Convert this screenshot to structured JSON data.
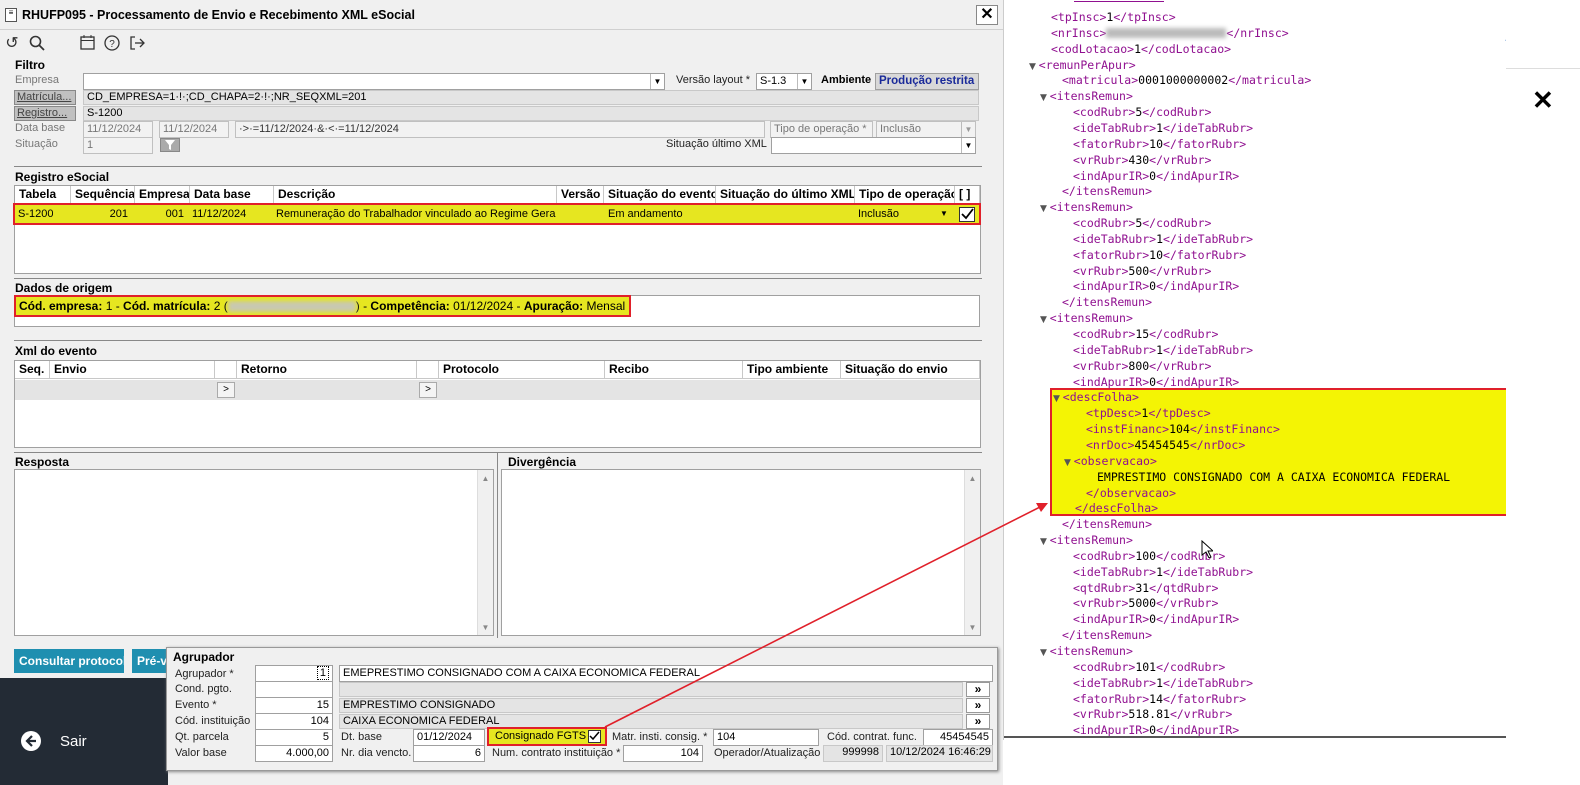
{
  "window": {
    "title": "RHUFP095 - Processamento de Envio e Recebimento XML eSocial",
    "close": "✕"
  },
  "toolbar": {
    "icons": [
      "refresh-icon",
      "search-icon",
      "calendar-icon",
      "help-icon",
      "exit-icon"
    ]
  },
  "filtro": {
    "title": "Filtro",
    "empresa_label": "Empresa",
    "empresa_value": "",
    "versao_label": "Versão layout *",
    "versao_value": "S-1.3",
    "ambiente_label": "Ambiente",
    "ambiente_value": "Produção restrita",
    "matricula_label": "Matrícula...",
    "matricula_value": "CD_EMPRESA=1·!·;CD_CHAPA=2·!·;NR_SEQXML=201",
    "registro_label": "Registro...",
    "registro_value": "S-1200",
    "database_label": "Data base",
    "date1": "11/12/2024",
    "date2": "11/12/2024",
    "date_expr": "·>·=11/12/2024·&·<·=11/12/2024",
    "tipo_op_label": "Tipo de operação *",
    "tipo_op_value": "Inclusão",
    "situacao_label": "Situação",
    "situacao_value": "1",
    "sit_ultimo_label": "Situação último XML",
    "sit_ultimo_value": ""
  },
  "registro": {
    "title": "Registro eSocial",
    "headers": [
      "Tabela",
      "Sequência",
      "Empresa",
      "Data base",
      "Descrição",
      "Versão",
      "Situação do evento",
      "Situação do último XML",
      "Tipo de operação",
      "[ ]"
    ],
    "row": {
      "tabela": "S-1200",
      "sequencia": "201",
      "empresa": "001",
      "database": "11/12/2024",
      "descricao": "Remuneração do Trabalhador vinculado ao Regime Geral d",
      "versao": "",
      "situacao": "Em andamento",
      "sit_ultimo": "",
      "tipo_op": "Inclusão"
    }
  },
  "origem": {
    "title": "Dados de origem",
    "l1": "Cód. empresa:",
    "v1": " 1 - ",
    "l2": "Cód. matrícula:",
    "v2": " 2 (",
    "v2b": ") - ",
    "l3": "Competência:",
    "v3": " 01/12/2024 - ",
    "l4": "Apuração:",
    "v4": " Mensal -"
  },
  "xml_evento": {
    "title": "Xml do evento",
    "headers": [
      "Seq.",
      "Envio",
      "",
      "Retorno",
      "",
      "Protocolo",
      "Recibo",
      "Tipo ambiente",
      "Situação do envio"
    ],
    "btn": ">"
  },
  "resposta": {
    "title": "Resposta"
  },
  "divergencia": {
    "title": "Divergência"
  },
  "buttons": {
    "consultar": "Consultar protocolo",
    "previa": "Pré-vis"
  },
  "sair": "Sair",
  "agrupador": {
    "title": "Agrupador",
    "agrupador_label": "Agrupador *",
    "agrupador_value": "1",
    "agrupador_desc": "EMEPRESTIMO CONSIGNADO COM A CAIXA ECONOMICA FEDERAL",
    "cond_label": "Cond. pgto.",
    "cond_value": "",
    "cond_desc": "",
    "evento_label": "Evento *",
    "evento_value": "15",
    "evento_desc": "EMPRESTIMO CONSIGNADO",
    "inst_label": "Cód. instituição",
    "inst_value": "104",
    "inst_desc": "CAIXA ECONOMICA FEDERAL",
    "qt_label": "Qt. parcela",
    "qt_value": "5",
    "dtbase_label": "Dt. base",
    "dtbase_value": "01/12/2024",
    "consignado_label": "Consignado FGTS",
    "matr_label": "Matr. insti. consig. *",
    "matr_value": "104",
    "codcontr_label": "Cód. contrat. func.",
    "codcontr_value": "45454545",
    "valor_label": "Valor base",
    "valor_value": "4.000,00",
    "nrdia_label": "Nr. dia vencto.",
    "nrdia_value": "6",
    "numcontr_label": "Num. contrato instituição *",
    "numcontr_value": "104",
    "oper_label": "Operador/Atualização",
    "oper_value": "999998",
    "oper_date": "10/12/2024 16:46:29",
    "more": "»"
  },
  "xml_lines": [
    {
      "i": 1,
      "t": "<tpInsc>",
      "v": "1",
      "c": "</tpInsc>"
    },
    {
      "i": 1,
      "t": "<nrInsc>",
      "v": "",
      "c": "</nrInsc>",
      "blur": true
    },
    {
      "i": 1,
      "t": "<codLotacao>",
      "v": "1",
      "c": "</codLotacao>"
    },
    {
      "i": 0,
      "tri": "▼",
      "t": "<remunPerApur>",
      "v": "",
      "c": ""
    },
    {
      "i": 2,
      "t": "<matricula>",
      "v": "0001000000002",
      "c": "</matricula>"
    },
    {
      "i": 1,
      "tri": "▼",
      "t": "<itensRemun>",
      "v": "",
      "c": ""
    },
    {
      "i": 3,
      "t": "<codRubr>",
      "v": "5",
      "c": "</codRubr>"
    },
    {
      "i": 3,
      "t": "<ideTabRubr>",
      "v": "1",
      "c": "</ideTabRubr>"
    },
    {
      "i": 3,
      "t": "<fatorRubr>",
      "v": "10",
      "c": "</fatorRubr>"
    },
    {
      "i": 3,
      "t": "<vrRubr>",
      "v": "430",
      "c": "</vrRubr>"
    },
    {
      "i": 3,
      "t": "<indApurIR>",
      "v": "0",
      "c": "</indApurIR>"
    },
    {
      "i": 2,
      "t": "</itensRemun>",
      "v": "",
      "c": ""
    },
    {
      "i": 1,
      "tri": "▼",
      "t": "<itensRemun>",
      "v": "",
      "c": ""
    },
    {
      "i": 3,
      "t": "<codRubr>",
      "v": "5",
      "c": "</codRubr>"
    },
    {
      "i": 3,
      "t": "<ideTabRubr>",
      "v": "1",
      "c": "</ideTabRubr>"
    },
    {
      "i": 3,
      "t": "<fatorRubr>",
      "v": "10",
      "c": "</fatorRubr>"
    },
    {
      "i": 3,
      "t": "<vrRubr>",
      "v": "500",
      "c": "</vrRubr>"
    },
    {
      "i": 3,
      "t": "<indApurIR>",
      "v": "0",
      "c": "</indApurIR>"
    },
    {
      "i": 2,
      "t": "</itensRemun>",
      "v": "",
      "c": ""
    },
    {
      "i": 1,
      "tri": "▼",
      "t": "<itensRemun>",
      "v": "",
      "c": ""
    },
    {
      "i": 3,
      "t": "<codRubr>",
      "v": "15",
      "c": "</codRubr>"
    },
    {
      "i": 3,
      "t": "<ideTabRubr>",
      "v": "1",
      "c": "</ideTabRubr>"
    },
    {
      "i": 3,
      "t": "<vrRubr>",
      "v": "800",
      "c": "</vrRubr>"
    },
    {
      "i": 3,
      "t": "<indApurIR>",
      "v": "0",
      "c": "</indApurIR>"
    },
    {
      "i": 2,
      "tri": "▼",
      "t": "<descFolha>",
      "v": "",
      "c": "",
      "hl": true
    },
    {
      "i": 4,
      "t": "<tpDesc>",
      "v": "1",
      "c": "</tpDesc>",
      "hl": true
    },
    {
      "i": 4,
      "t": "<instFinanc>",
      "v": "104",
      "c": "</instFinanc>",
      "hl": true
    },
    {
      "i": 4,
      "t": "<nrDoc>",
      "v": "45454545",
      "c": "</nrDoc>",
      "hl": true
    },
    {
      "i": 3,
      "tri": "▼",
      "t": "<observacao>",
      "v": "",
      "c": "",
      "hl": true
    },
    {
      "i": 5,
      "t": "",
      "v": "EMPRESTIMO CONSIGNADO COM A CAIXA ECONOMICA FEDERAL",
      "c": "",
      "hl": true
    },
    {
      "i": 4,
      "t": "</observacao>",
      "v": "",
      "c": "",
      "hl": true
    },
    {
      "i": 3,
      "t": "</descFolha>",
      "v": "",
      "c": "",
      "hl": true
    },
    {
      "i": 2,
      "t": "</itensRemun>",
      "v": "",
      "c": ""
    },
    {
      "i": 1,
      "tri": "▼",
      "t": "<itensRemun>",
      "v": "",
      "c": ""
    },
    {
      "i": 3,
      "t": "<codRubr>",
      "v": "100",
      "c": "</codRubr>"
    },
    {
      "i": 3,
      "t": "<ideTabRubr>",
      "v": "1",
      "c": "</ideTabRubr>"
    },
    {
      "i": 3,
      "t": "<qtdRubr>",
      "v": "31",
      "c": "</qtdRubr>"
    },
    {
      "i": 3,
      "t": "<vrRubr>",
      "v": "5000",
      "c": "</vrRubr>"
    },
    {
      "i": 3,
      "t": "<indApurIR>",
      "v": "0",
      "c": "</indApurIR>"
    },
    {
      "i": 2,
      "t": "</itensRemun>",
      "v": "",
      "c": ""
    },
    {
      "i": 1,
      "tri": "▼",
      "t": "<itensRemun>",
      "v": "",
      "c": ""
    },
    {
      "i": 3,
      "t": "<codRubr>",
      "v": "101",
      "c": "</codRubr>"
    },
    {
      "i": 3,
      "t": "<ideTabRubr>",
      "v": "1",
      "c": "</ideTabRubr>"
    },
    {
      "i": 3,
      "t": "<fatorRubr>",
      "v": "14",
      "c": "</fatorRubr>"
    },
    {
      "i": 3,
      "t": "<vrRubr>",
      "v": "518.81",
      "c": "</vrRubr>"
    },
    {
      "i": 3,
      "t": "<indApurIR>",
      "v": "0",
      "c": "</indApurIR>"
    }
  ],
  "close_x": "✕",
  "colors": {
    "highlight": "#e6e620",
    "red": "#e0202a",
    "tag": "#901090",
    "blue": "#1f8fb0",
    "ambiente": "#1a2a9a"
  }
}
